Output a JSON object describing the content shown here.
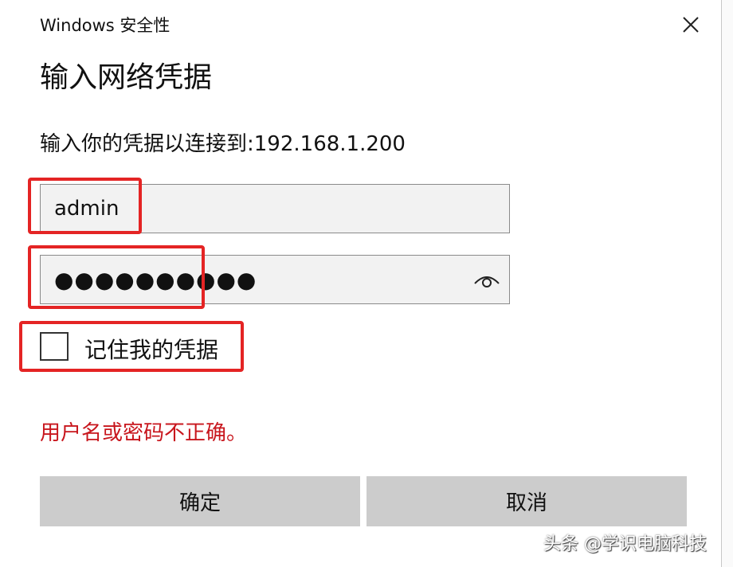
{
  "window": {
    "title": "Windows 安全性"
  },
  "dialog": {
    "heading": "输入网络凭据",
    "subtext": "输入你的凭据以连接到:192.168.1.200"
  },
  "username": {
    "value": "admin"
  },
  "password": {
    "value": "●●●●●●●●●●"
  },
  "remember": {
    "label": "记住我的凭据",
    "checked": false
  },
  "error": {
    "message": "用户名或密码不正确。",
    "color": "#c8161d"
  },
  "buttons": {
    "ok_label": "确定",
    "cancel_label": "取消"
  },
  "highlight_color": "#e42424",
  "watermark": {
    "text": "头条 @学识电脑科技"
  }
}
